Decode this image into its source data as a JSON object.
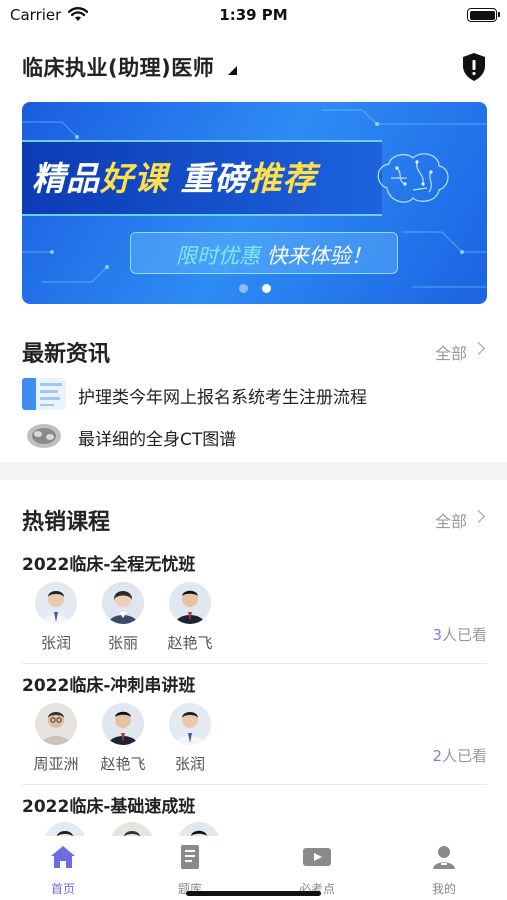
{
  "status_bar": {
    "carrier": "Carrier",
    "time": "1:39 PM"
  },
  "header": {
    "title": "临床执业(助理)医师",
    "shield_icon": "shield-icon"
  },
  "banner": {
    "headline_part1": "精品",
    "headline_part2": "好课",
    "headline_part3": " 重磅",
    "headline_part4": "推荐",
    "promo_part1": "限时优惠",
    "promo_part2": " 快来体验！",
    "active_dot": 1
  },
  "news": {
    "title": "最新资讯",
    "all_label": "全部",
    "items": [
      {
        "text": "护理类今年网上报名系统考生注册流程",
        "thumb": "document-thumbnail"
      },
      {
        "text": "最详细的全身CT图谱",
        "thumb": "ct-scan-thumbnail"
      }
    ]
  },
  "courses": {
    "title": "热销课程",
    "all_label": "全部",
    "items": [
      {
        "name": "2022临床-全程无忧班",
        "teachers": [
          "张润",
          "张丽",
          "赵艳飞"
        ],
        "views_count": "3",
        "views_suffix": "人已看"
      },
      {
        "name": "2022临床-冲刺串讲班",
        "teachers": [
          "周亚洲",
          "赵艳飞",
          "张润"
        ],
        "views_count": "2",
        "views_suffix": "人已看"
      },
      {
        "name": "2022临床-基础速成班",
        "teachers": [
          "",
          "",
          ""
        ],
        "views_count": "",
        "views_suffix": ""
      }
    ]
  },
  "tabbar": {
    "tabs": [
      {
        "label": "首页",
        "icon": "home-icon",
        "active": true
      },
      {
        "label": "题库",
        "icon": "book-icon",
        "active": false
      },
      {
        "label": "必考点",
        "icon": "video-icon",
        "active": false
      },
      {
        "label": "我的",
        "icon": "profile-icon",
        "active": false
      }
    ]
  },
  "colors": {
    "accent": "#6a6ee0",
    "banner_blue": "#1a5de0",
    "highlight_yellow": "#ffe04a"
  }
}
